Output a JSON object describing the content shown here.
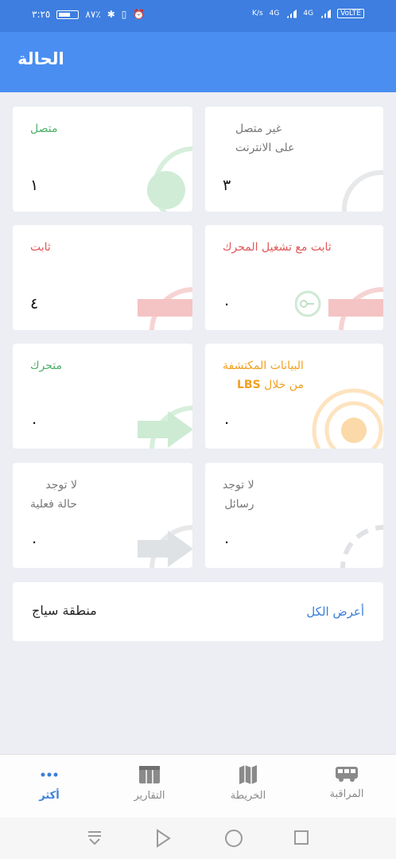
{
  "status_bar": {
    "time": "٣:٢٥",
    "battery": "٨٧٪",
    "network_speed": "K/s",
    "signal_1": "4G",
    "signal_2": "4G",
    "volte": "VoLTE"
  },
  "header": {
    "title": "الحالة"
  },
  "cards": [
    {
      "label_line1": "متصل",
      "label_line2": "",
      "count": "١",
      "label_color": "#4caf6a",
      "icon": "connected-icon"
    },
    {
      "label_line1": "غير متصل",
      "label_line2": "على الانترنت",
      "count": "٣",
      "label_color": "#777777",
      "icon": "offline-icon"
    },
    {
      "label_line1": "ثابت",
      "label_line2": "",
      "count": "٤",
      "label_color": "#e05757",
      "icon": "stopped-icon"
    },
    {
      "label_line1": "ثابت مع تشغيل المحرك",
      "label_line2": "",
      "count": "٠",
      "label_color": "#e05757",
      "icon": "idle-engine-icon"
    },
    {
      "label_line1": "متحرك",
      "label_line2": "",
      "count": "٠",
      "label_color": "#4caf6a",
      "icon": "moving-icon"
    },
    {
      "label_line1": "البيانات المكتشفة",
      "label_line2": "من خلال",
      "label_line2_bold": "LBS",
      "count": "٠",
      "label_color": "#f0a020",
      "icon": "lbs-icon"
    },
    {
      "label_line1": "لا توجد",
      "label_line2": "حالة فعلية",
      "count": "٠",
      "label_color": "#777777",
      "icon": "no-status-icon"
    },
    {
      "label_line1": "لا توجد",
      "label_line2": "رسائل",
      "count": "٠",
      "label_color": "#777777",
      "icon": "no-messages-icon"
    }
  ],
  "geofence": {
    "title": "منطقة سياج",
    "view_all": "أعرض الكل"
  },
  "bottom_nav": {
    "items": [
      {
        "label": "المراقبة",
        "icon": "bus-icon",
        "active": false
      },
      {
        "label": "الخريطة",
        "icon": "map-icon",
        "active": false
      },
      {
        "label": "التقارير",
        "icon": "table-icon",
        "active": false
      },
      {
        "label": "أكثر",
        "icon": "more-dots-icon",
        "active": true
      }
    ]
  },
  "colors": {
    "accent": "#4a8ef2",
    "green": "#4caf6a",
    "red": "#e05757",
    "orange": "#f0a020",
    "grey": "#777777"
  }
}
